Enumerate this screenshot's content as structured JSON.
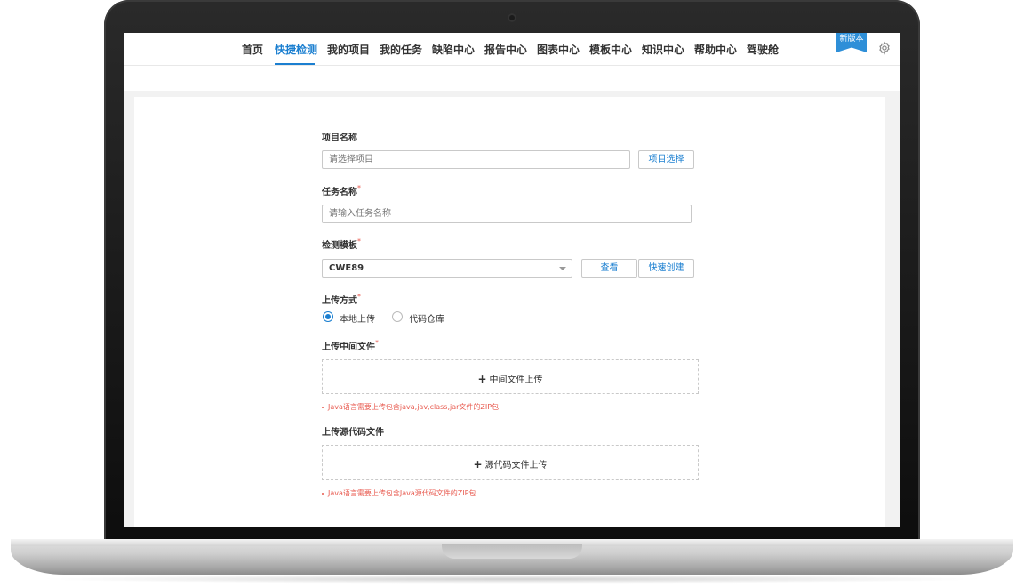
{
  "nav": {
    "items": [
      {
        "label": "首页"
      },
      {
        "label": "快捷检测",
        "active": true
      },
      {
        "label": "我的项目"
      },
      {
        "label": "我的任务"
      },
      {
        "label": "缺陷中心"
      },
      {
        "label": "报告中心"
      },
      {
        "label": "图表中心"
      },
      {
        "label": "模板中心"
      },
      {
        "label": "知识中心"
      },
      {
        "label": "帮助中心"
      },
      {
        "label": "驾驶舱"
      }
    ],
    "badge": "新版本",
    "settings_icon": "gear-icon",
    "accent_color": "#1b7fd0"
  },
  "form": {
    "project": {
      "label": "项目名称",
      "placeholder": "请选择项目",
      "button": "项目选择"
    },
    "task": {
      "label": "任务名称",
      "required": "*",
      "placeholder": "请输入任务名称"
    },
    "template": {
      "label": "检测模板",
      "required": "*",
      "value": "CWE89",
      "view_button": "查看",
      "create_button": "快速创建"
    },
    "upload_method": {
      "label": "上传方式",
      "required": "*",
      "options": [
        {
          "label": "本地上传",
          "checked": true
        },
        {
          "label": "代码仓库",
          "checked": false
        }
      ]
    },
    "intermediate": {
      "label": "上传中间文件",
      "required": "*",
      "plus": "+",
      "dropzone": "中间文件上传",
      "hint": "Java语言需要上传包含java,jav,class,jar文件的ZIP包"
    },
    "source": {
      "label": "上传源代码文件",
      "plus": "+",
      "dropzone": "源代码文件上传",
      "hint": "Java语言需要上传包含Java源代码文件的ZIP包"
    }
  },
  "colors": {
    "error": "#e85a4f",
    "ribbon": "#2e8fd8"
  }
}
